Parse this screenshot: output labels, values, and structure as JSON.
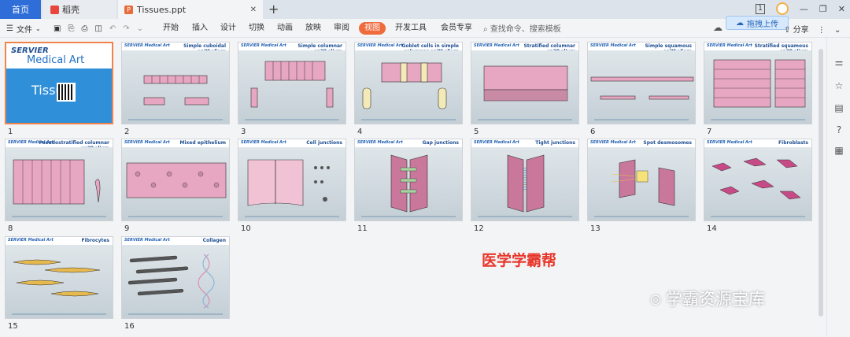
{
  "tabs": [
    {
      "label": "首页",
      "active": true
    },
    {
      "label": "稻壳",
      "icon": "daoke-icon"
    },
    {
      "label": "Tissues.ppt",
      "icon": "ppt-icon"
    }
  ],
  "window": {
    "badge": "1"
  },
  "toolbar": {
    "file_label": "文件",
    "menu": [
      "开始",
      "插入",
      "设计",
      "切换",
      "动画",
      "放映",
      "审阅",
      "视图",
      "开发工具",
      "会员专享"
    ],
    "active_menu": "视图",
    "search_placeholder": "查找命令、搜索模板",
    "upload_label": "拖拽上传",
    "share_label": "分享"
  },
  "slides": [
    {
      "num": "1",
      "title": "",
      "brand": "SERVIER",
      "cover_title": "SERVIER",
      "cover_sub": "Medical Art",
      "cover_word": "Tissu"
    },
    {
      "num": "2",
      "title": "Simple cuboidal epithelium",
      "brand": "SERVIER Medical Art"
    },
    {
      "num": "3",
      "title": "Simple columnar epithelium",
      "brand": "SERVIER Medical Art"
    },
    {
      "num": "4",
      "title": "Goblet cells in simple columnar epithelium",
      "brand": "SERVIER Medical Art"
    },
    {
      "num": "5",
      "title": "Stratified columnar epithelium",
      "brand": "SERVIER Medical Art"
    },
    {
      "num": "6",
      "title": "Simple squamous epithelium",
      "brand": "SERVIER Medical Art"
    },
    {
      "num": "7",
      "title": "Stratified squamous epithelium",
      "brand": "SERVIER Medical Art"
    },
    {
      "num": "8",
      "title": "Pseudostratified columnar epithelium",
      "brand": "SERVIER Medical Art"
    },
    {
      "num": "9",
      "title": "Mixed epithelium",
      "brand": "SERVIER Medical Art"
    },
    {
      "num": "10",
      "title": "Cell junctions",
      "brand": "SERVIER Medical Art"
    },
    {
      "num": "11",
      "title": "Gap junctions",
      "brand": "SERVIER Medical Art"
    },
    {
      "num": "12",
      "title": "Tight junctions",
      "brand": "SERVIER Medical Art"
    },
    {
      "num": "13",
      "title": "Spot desmosomes",
      "brand": "SERVIER Medical Art"
    },
    {
      "num": "14",
      "title": "Fibroblasts",
      "brand": "SERVIER Medical Art"
    },
    {
      "num": "15",
      "title": "Fibrocytes",
      "brand": "SERVIER Medical Art"
    },
    {
      "num": "16",
      "title": "Collagen",
      "brand": "SERVIER Medical Art"
    }
  ],
  "watermarks": {
    "red": "医学学霸帮",
    "gray": "学霸资源宝库"
  },
  "colors": {
    "accent": "#f06a3c",
    "home_tab": "#2f6ed8",
    "cell_pink": "#e7a6c1",
    "selected_border": "#f0834c"
  }
}
